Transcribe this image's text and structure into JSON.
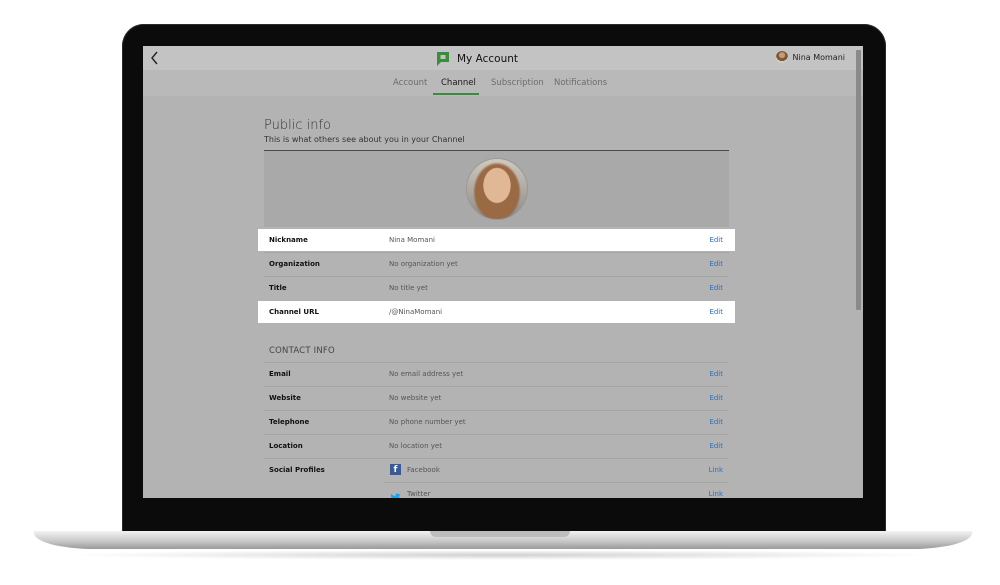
{
  "app": {
    "title": "My Account",
    "user_name": "Nina Momani"
  },
  "tabs": [
    {
      "label": "Account",
      "active": false
    },
    {
      "label": "Channel",
      "active": true
    },
    {
      "label": "Subscription",
      "active": false
    },
    {
      "label": "Notifications",
      "active": false
    }
  ],
  "public_info": {
    "title": "Public info",
    "subtitle": "This is what others see about you in your Channel",
    "rows": [
      {
        "label": "Nickname",
        "value": "Nina Momani",
        "action": "Edit",
        "highlight": true
      },
      {
        "label": "Organization",
        "value": "No organization yet",
        "action": "Edit",
        "highlight": false
      },
      {
        "label": "Title",
        "value": "No title yet",
        "action": "Edit",
        "highlight": false
      },
      {
        "label": "Channel URL",
        "value": "/@NinaMomani",
        "action": "Edit",
        "highlight": true
      }
    ]
  },
  "contact_info": {
    "title": "CONTACT INFO",
    "rows": [
      {
        "label": "Email",
        "value": "No email address yet",
        "action": "Edit"
      },
      {
        "label": "Website",
        "value": "No website yet",
        "action": "Edit"
      },
      {
        "label": "Telephone",
        "value": "No phone number yet",
        "action": "Edit"
      },
      {
        "label": "Location",
        "value": "No location yet",
        "action": "Edit"
      }
    ],
    "social": {
      "label": "Social Profiles",
      "items": [
        {
          "name": "Facebook",
          "action": "Link",
          "icon": "facebook-icon"
        },
        {
          "name": "Twitter",
          "action": "Link",
          "icon": "twitter-icon"
        }
      ]
    }
  },
  "colors": {
    "accent": "#3a8e3a",
    "link": "#2b6fbf",
    "facebook": "#3b5998",
    "twitter": "#1da1f2"
  }
}
